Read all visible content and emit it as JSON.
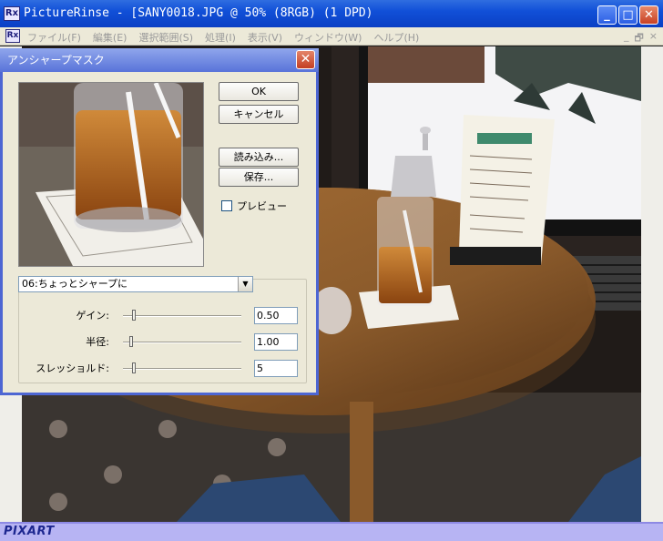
{
  "window": {
    "title": "PictureRinse - [SANY0018.JPG @ 50% (8RGB) (1 DPD)",
    "app_icon_text": "Rx",
    "controls": [
      "_",
      "□",
      "✕"
    ]
  },
  "menubar": {
    "items": [
      "ファイル(F)",
      "編集(E)",
      "選択範囲(S)",
      "処理(I)",
      "表示(V)",
      "ウィンドウ(W)",
      "ヘルプ(H)"
    ],
    "mdi_controls": [
      "_",
      "🗗",
      "×"
    ]
  },
  "status": {
    "brand": "PIXART"
  },
  "dialog": {
    "title": "アンシャープマスク",
    "close": "✕",
    "buttons": {
      "ok": "OK",
      "cancel": "キャンセル",
      "load": "読み込み...",
      "save": "保存..."
    },
    "preview_checkbox": {
      "label": "プレビュー",
      "checked": false
    },
    "preset": {
      "selected": "06:ちょっとシャープに",
      "arrow": "▼"
    },
    "params": [
      {
        "label": "ゲイン:",
        "value": "0.50",
        "slider_fraction": 0.08
      },
      {
        "label": "半径:",
        "value": "1.00",
        "slider_fraction": 0.05
      },
      {
        "label": "スレッショルド:",
        "value": "5",
        "slider_fraction": 0.08
      }
    ]
  },
  "colors": {
    "title_bar": "#1150d8",
    "dialog_title": "#7088e2",
    "status_bar": "#b7b4f3",
    "table_wood": "#8a5a2b",
    "tea": "#b5651d"
  },
  "icons": {
    "app": "picturerinse-app-icon",
    "minimize": "minimize-icon",
    "maximize": "maximize-icon",
    "close": "close-icon",
    "dropdown": "chevron-down-icon"
  }
}
